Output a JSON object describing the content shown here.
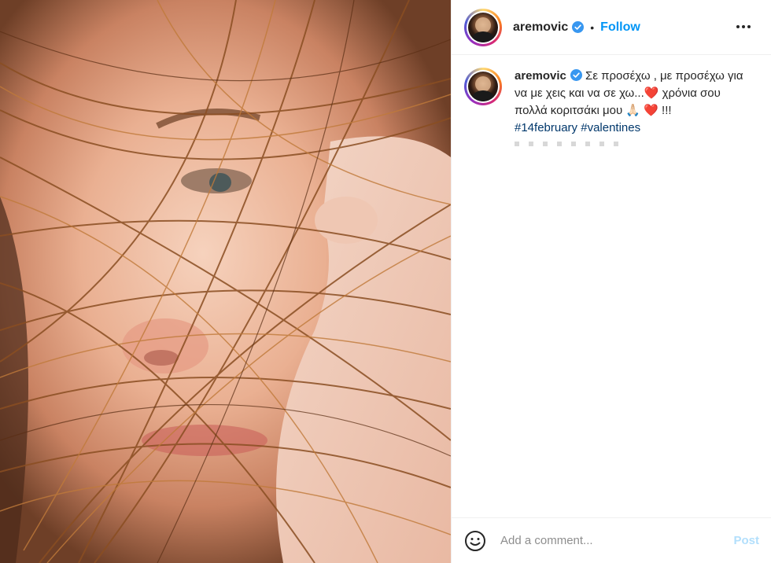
{
  "header": {
    "username": "aremovic",
    "separator": "•",
    "follow_label": "Follow",
    "more_icon": "more-horizontal-icon"
  },
  "caption": {
    "username": "aremovic",
    "text_line1": "Σε προσέχω , με προσέχω για να με χεις και να σε χω...",
    "heart1": "❤️",
    "text_line2": " χρόνια σου πολλά κοριτσάκι μου ",
    "emoji2": "🙏🏻",
    "heart2": "❤️",
    "text_end": " !!!",
    "hashtag1": "#14february",
    "hashtag2": "#valentines"
  },
  "footer": {
    "emoji_icon": "smiley-icon",
    "placeholder": "Add a comment...",
    "post_label": "Post"
  },
  "colors": {
    "accent": "#0095f6",
    "hashtag": "#00376b",
    "verified": "#3897f0",
    "post_disabled": "#b2dffc"
  }
}
